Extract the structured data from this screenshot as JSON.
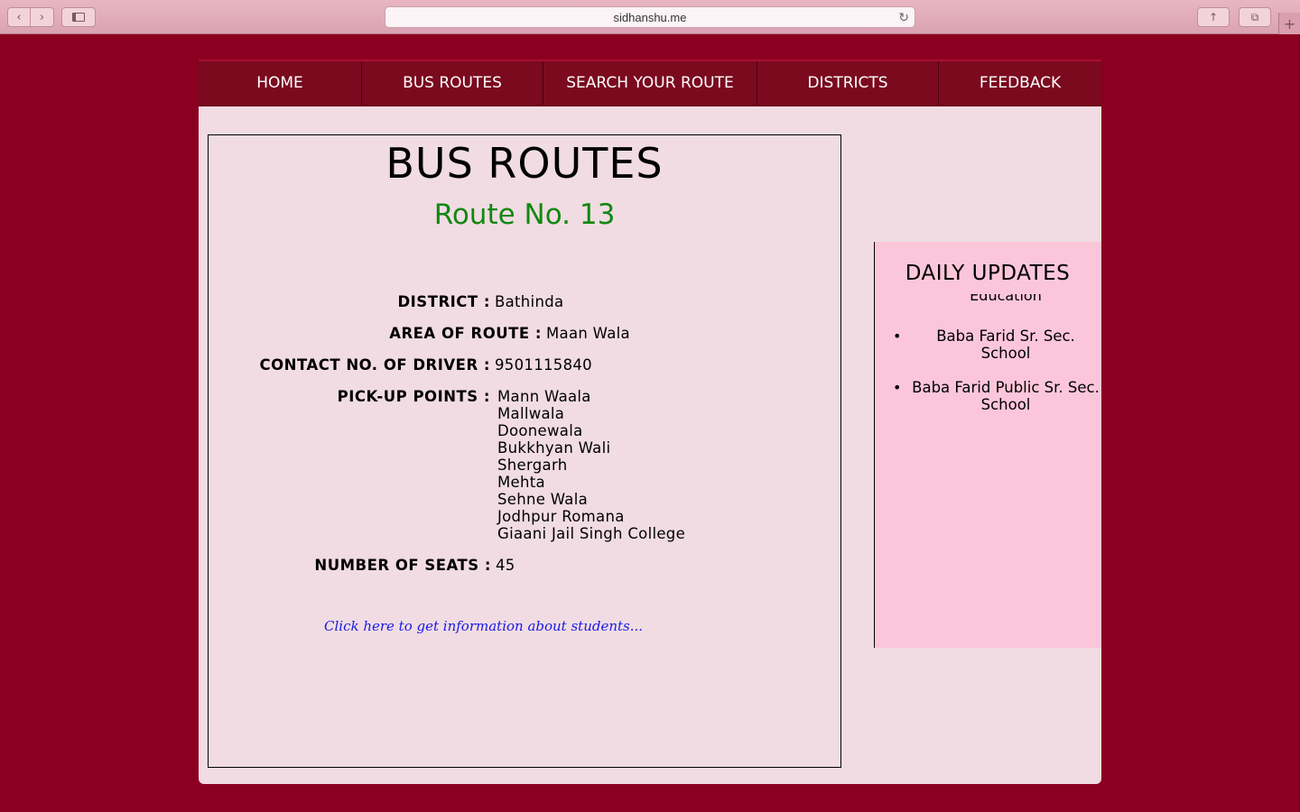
{
  "browser": {
    "url": "sidhanshu.me",
    "back_icon": "chevron-left-icon",
    "forward_icon": "chevron-right-icon",
    "reload_icon": "reload-icon",
    "share_icon": "share-icon",
    "tabs_icon": "tabs-icon",
    "new_tab_label": "+"
  },
  "nav": {
    "items": [
      {
        "label": "HOME"
      },
      {
        "label": "BUS ROUTES"
      },
      {
        "label": "SEARCH YOUR ROUTE"
      },
      {
        "label": "DISTRICTS"
      },
      {
        "label": "FEEDBACK"
      }
    ]
  },
  "main": {
    "title": "BUS ROUTES",
    "route_no": "Route No. 13",
    "district_label": "DISTRICT :",
    "district_value": "Bathinda",
    "area_label": "AREA OF ROUTE :",
    "area_value": "Maan Wala",
    "contact_label": "CONTACT NO. OF DRIVER :",
    "contact_value": "9501115840",
    "pickup_label": "PICK-UP POINTS :",
    "pickup_points": [
      "Mann Waala",
      "Mallwala",
      "Doonewala",
      "Bukkhyan Wali",
      "Shergarh",
      "Mehta",
      "Sehne Wala",
      "Jodhpur Romana",
      "Giaani Jail Singh College"
    ],
    "seats_label": "NUMBER OF SEATS :",
    "seats_value": "45",
    "student_link": "Click here to get information about students..."
  },
  "updates": {
    "title": "DAILY UPDATES",
    "ticker": "Education",
    "items": [
      "Baba Farid Sr. Sec. School",
      "Baba Farid Public Sr. Sec. School"
    ]
  },
  "colors": {
    "page_bg": "#8b0020",
    "nav_bg": "#7b0a1f",
    "panel_bg": "#f1dce3",
    "updates_bg": "#fcc6da",
    "route_green": "#118811",
    "link_blue": "#1a1ae6"
  }
}
